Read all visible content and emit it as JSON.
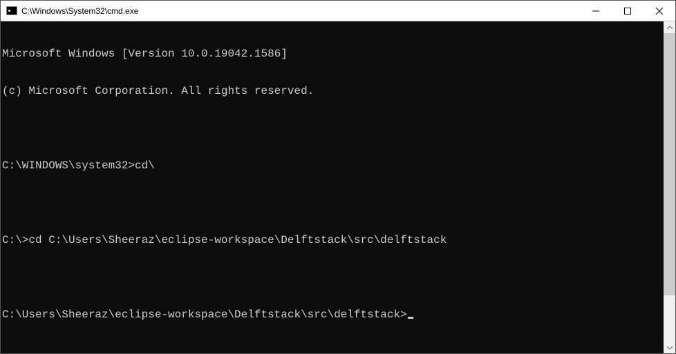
{
  "window": {
    "title": "C:\\Windows\\System32\\cmd.exe"
  },
  "terminal": {
    "lines": [
      "Microsoft Windows [Version 10.0.19042.1586]",
      "(c) Microsoft Corporation. All rights reserved.",
      "",
      "C:\\WINDOWS\\system32>cd\\",
      "",
      "C:\\>cd C:\\Users\\Sheeraz\\eclipse-workspace\\Delftstack\\src\\delftstack",
      "",
      "C:\\Users\\Sheeraz\\eclipse-workspace\\Delftstack\\src\\delftstack>"
    ],
    "header_version": "Microsoft Windows [Version 10.0.19042.1586]",
    "header_copyright": "(c) Microsoft Corporation. All rights reserved.",
    "prompt1": "C:\\WINDOWS\\system32>",
    "command1": "cd\\",
    "prompt2": "C:\\>",
    "command2": "cd C:\\Users\\Sheeraz\\eclipse-workspace\\Delftstack\\src\\delftstack",
    "prompt3": "C:\\Users\\Sheeraz\\eclipse-workspace\\Delftstack\\src\\delftstack>"
  }
}
